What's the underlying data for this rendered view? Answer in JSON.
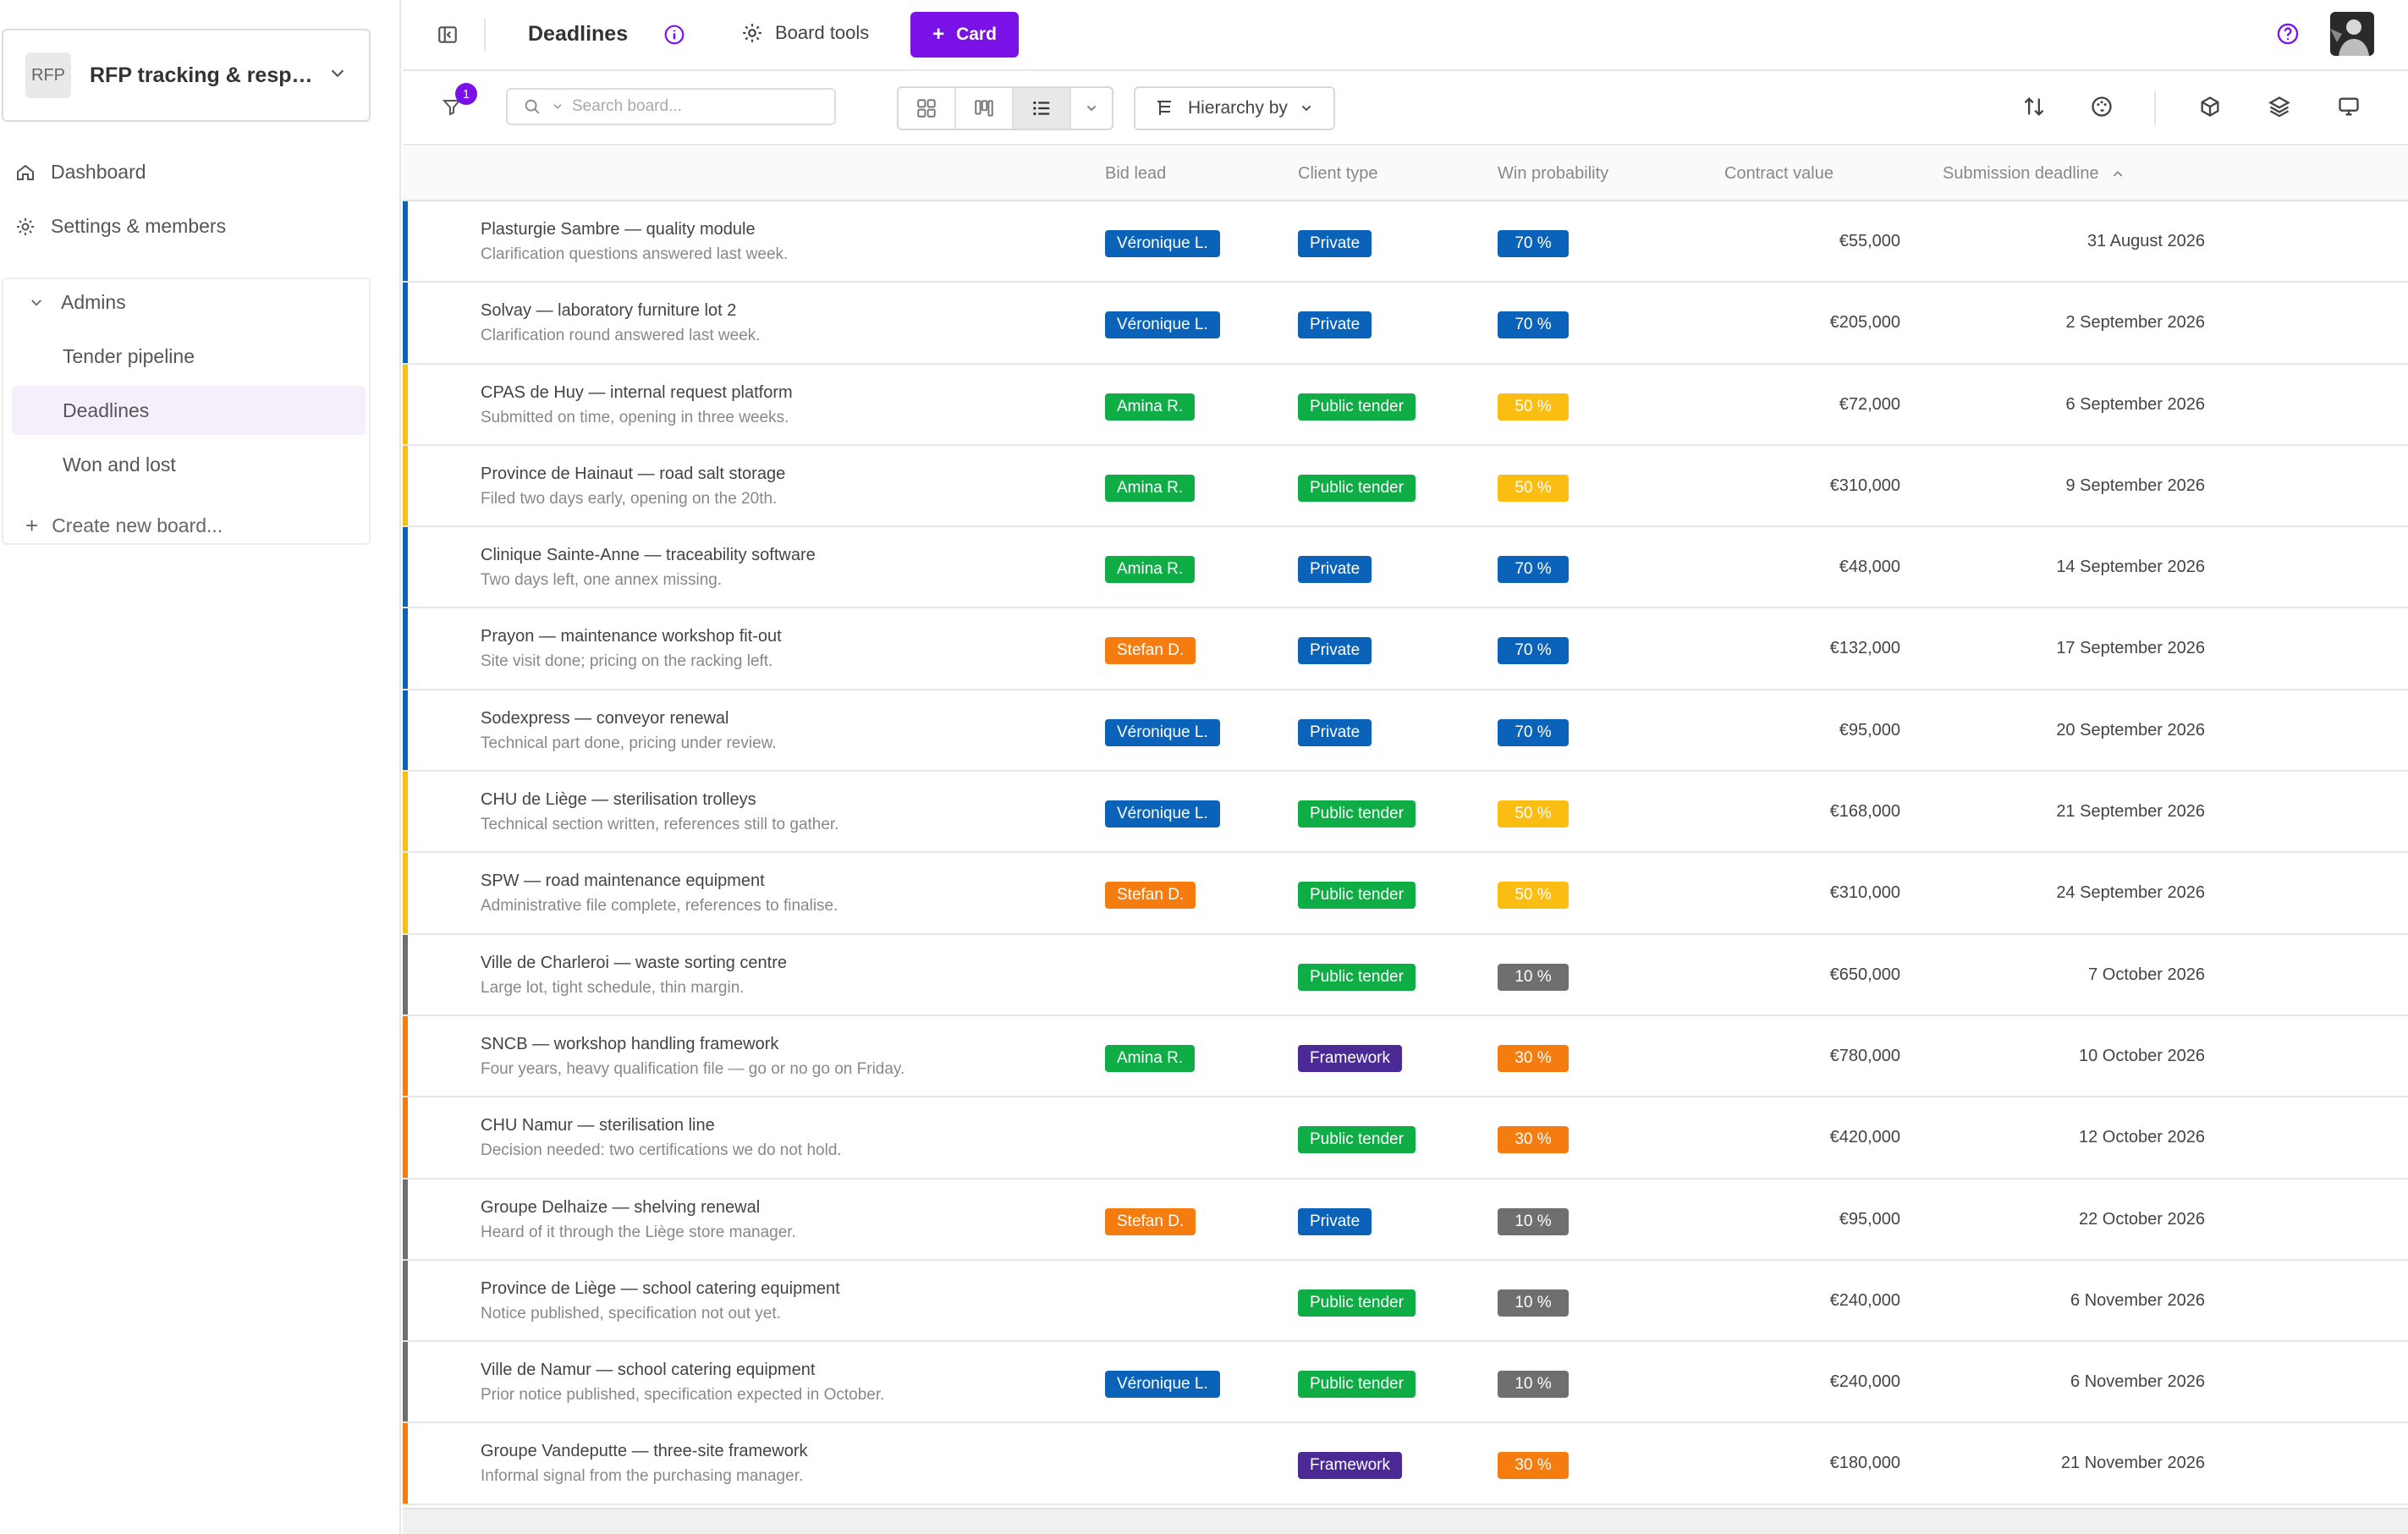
{
  "sidebar": {
    "workspace": {
      "badge": "RFP",
      "name": "RFP tracking & responses"
    },
    "nav": [
      {
        "label": "Dashboard",
        "icon": "home-icon"
      },
      {
        "label": "Settings & members",
        "icon": "gear-icon"
      }
    ],
    "group": {
      "label": "Admins",
      "boards": [
        {
          "label": "Tender pipeline",
          "active": false
        },
        {
          "label": "Deadlines",
          "active": true
        },
        {
          "label": "Won and lost",
          "active": false
        }
      ],
      "create_label": "Create new board..."
    }
  },
  "topbar": {
    "title": "Deadlines",
    "board_tools_label": "Board tools",
    "card_button_label": "Card"
  },
  "toolbar": {
    "filter_count": "1",
    "search_placeholder": "Search board...",
    "hierarchy_label": "Hierarchy by"
  },
  "table": {
    "columns": {
      "bid_lead": "Bid lead",
      "client_type": "Client type",
      "win_probability": "Win probability",
      "contract_value": "Contract value",
      "submission_deadline": "Submission deadline"
    },
    "rows": [
      {
        "title": "Plasturgie Sambre — quality module",
        "note": "Clarification questions answered last week.",
        "lead": "Véronique L.",
        "type": "Private",
        "prob": "70 %",
        "value": "€55,000",
        "deadline": "31 August 2026"
      },
      {
        "title": "Solvay — laboratory furniture lot 2",
        "note": "Clarification round answered last week.",
        "lead": "Véronique L.",
        "type": "Private",
        "prob": "70 %",
        "value": "€205,000",
        "deadline": "2 September 2026"
      },
      {
        "title": "CPAS de Huy — internal request platform",
        "note": "Submitted on time, opening in three weeks.",
        "lead": "Amina R.",
        "type": "Public tender",
        "prob": "50 %",
        "value": "€72,000",
        "deadline": "6 September 2026"
      },
      {
        "title": "Province de Hainaut — road salt storage",
        "note": "Filed two days early, opening on the 20th.",
        "lead": "Amina R.",
        "type": "Public tender",
        "prob": "50 %",
        "value": "€310,000",
        "deadline": "9 September 2026"
      },
      {
        "title": "Clinique Sainte-Anne — traceability software",
        "note": "Two days left, one annex missing.",
        "lead": "Amina R.",
        "type": "Private",
        "prob": "70 %",
        "value": "€48,000",
        "deadline": "14 September 2026"
      },
      {
        "title": "Prayon — maintenance workshop fit-out",
        "note": "Site visit done; pricing on the racking left.",
        "lead": "Stefan D.",
        "type": "Private",
        "prob": "70 %",
        "value": "€132,000",
        "deadline": "17 September 2026"
      },
      {
        "title": "Sodexpress — conveyor renewal",
        "note": "Technical part done, pricing under review.",
        "lead": "Véronique L.",
        "type": "Private",
        "prob": "70 %",
        "value": "€95,000",
        "deadline": "20 September 2026"
      },
      {
        "title": "CHU de Liège — sterilisation trolleys",
        "note": "Technical section written, references still to gather.",
        "lead": "Véronique L.",
        "type": "Public tender",
        "prob": "50 %",
        "value": "€168,000",
        "deadline": "21 September 2026"
      },
      {
        "title": "SPW — road maintenance equipment",
        "note": "Administrative file complete, references to finalise.",
        "lead": "Stefan D.",
        "type": "Public tender",
        "prob": "50 %",
        "value": "€310,000",
        "deadline": "24 September 2026"
      },
      {
        "title": "Ville de Charleroi — waste sorting centre",
        "note": "Large lot, tight schedule, thin margin.",
        "lead": "",
        "type": "Public tender",
        "prob": "10 %",
        "value": "€650,000",
        "deadline": "7 October 2026"
      },
      {
        "title": "SNCB — workshop handling framework",
        "note": "Four years, heavy qualification file — go or no go on Friday.",
        "lead": "Amina R.",
        "type": "Framework",
        "prob": "30 %",
        "value": "€780,000",
        "deadline": "10 October 2026"
      },
      {
        "title": "CHU Namur — sterilisation line",
        "note": "Decision needed: two certifications we do not hold.",
        "lead": "",
        "type": "Public tender",
        "prob": "30 %",
        "value": "€420,000",
        "deadline": "12 October 2026"
      },
      {
        "title": "Groupe Delhaize — shelving renewal",
        "note": "Heard of it through the Liège store manager.",
        "lead": "Stefan D.",
        "type": "Private",
        "prob": "10 %",
        "value": "€95,000",
        "deadline": "22 October 2026"
      },
      {
        "title": "Province de Liège — school catering equipment",
        "note": "Notice published, specification not out yet.",
        "lead": "",
        "type": "Public tender",
        "prob": "10 %",
        "value": "€240,000",
        "deadline": "6 November 2026"
      },
      {
        "title": "Ville de Namur — school catering equipment",
        "note": "Prior notice published, specification expected in October.",
        "lead": "Véronique L.",
        "type": "Public tender",
        "prob": "10 %",
        "value": "€240,000",
        "deadline": "6 November 2026"
      },
      {
        "title": "Groupe Vandeputte — three-site framework",
        "note": "Informal signal from the purchasing manager.",
        "lead": "",
        "type": "Framework",
        "prob": "30 %",
        "value": "€180,000",
        "deadline": "21 November 2026"
      }
    ]
  },
  "colors": {
    "accent": "#7a12e8",
    "lead": {
      "Véronique L.": "#0a63b8",
      "Amina R.": "#0fad45",
      "Stefan D.": "#f57c0f"
    },
    "type": {
      "Private": "#0a63b8",
      "Public tender": "#0fad45",
      "Framework": "#4b2a96"
    },
    "prob": {
      "70 %": "#0a63b8",
      "50 %": "#fbbd12",
      "30 %": "#f57c0f",
      "10 %": "#6f6f6f"
    }
  }
}
